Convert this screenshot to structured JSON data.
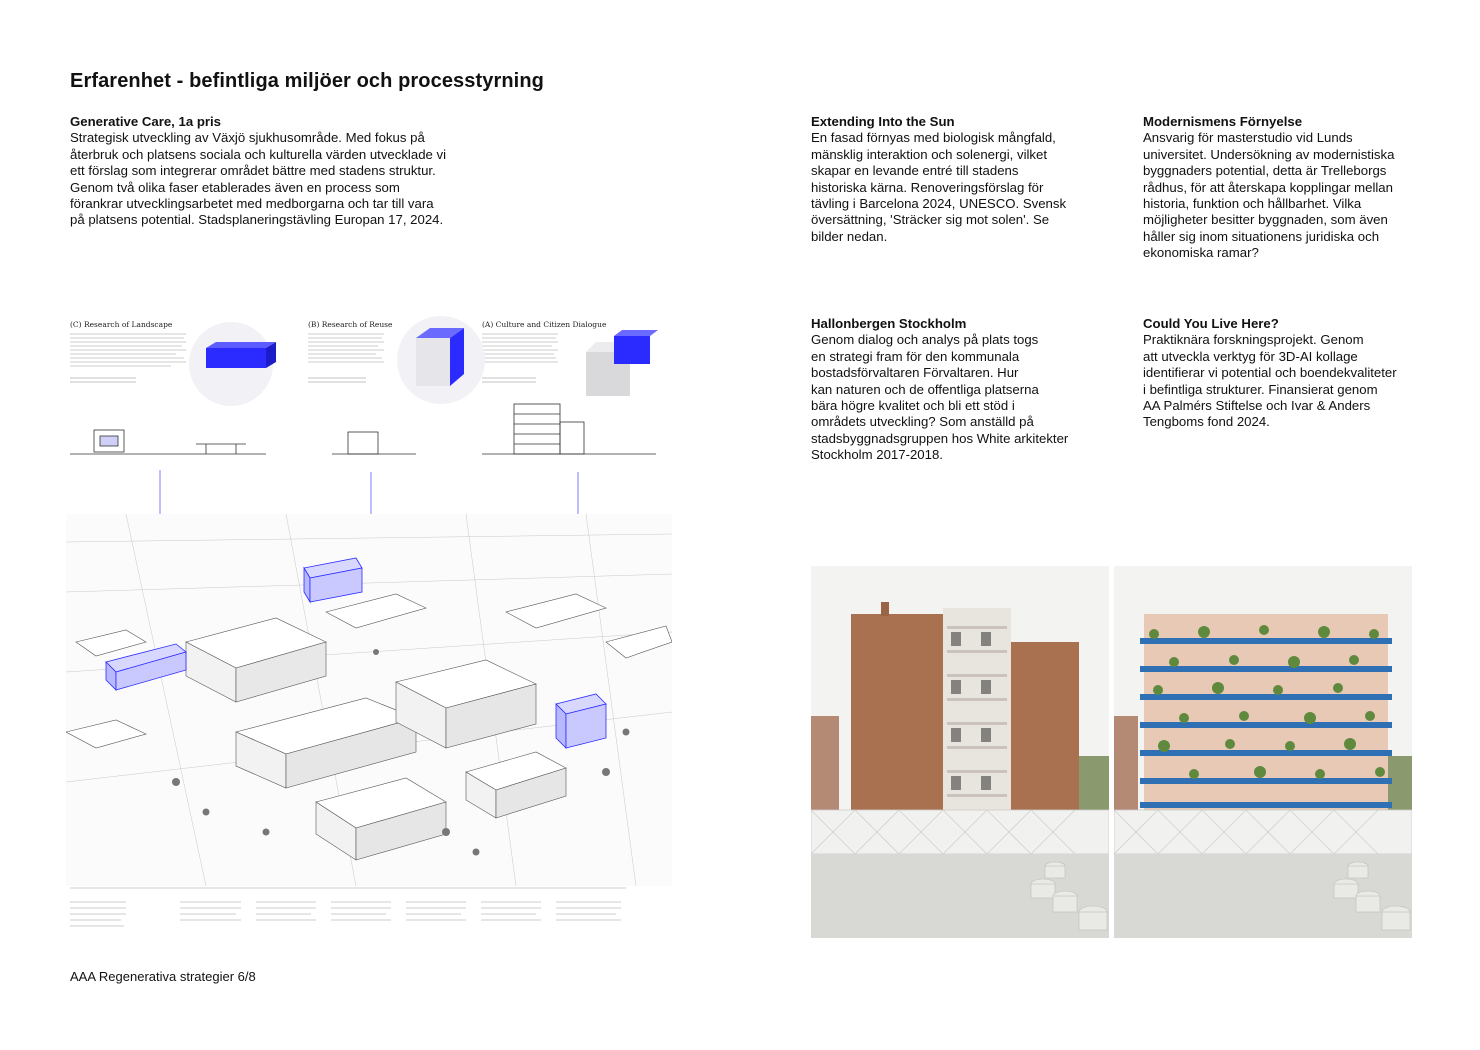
{
  "page": {
    "title": "Erfarenhet - befintliga miljöer och processtyrning",
    "footer": "AAA Regenerativa strategier 6/8"
  },
  "projects": [
    {
      "heading": "Generative Care, 1a pris",
      "text": "Strategisk utveckling av Växjö sjukhusområde. Med fokus på\nåterbruk och platsens sociala och kulturella värden utvecklade vi\nett förslag som integrerar området bättre med stadens struktur.\nGenom två olika faser etablerades även en process som\nförankrar utvecklingsarbetet med medborgarna och tar till vara\npå platsens potential. Stadsplaneringstävling Europan 17, 2024."
    },
    {
      "heading": "Extending Into the Sun",
      "text": "En fasad förnyas med biologisk mångfald,\nmänsklig interaktion och solenergi, vilket\nskapar en levande entré till stadens\nhistoriska kärna. Renoveringsförslag för\ntävling i Barcelona 2024, UNESCO. Svensk\növersättning, 'Sträcker sig mot solen'. Se\nbilder nedan."
    },
    {
      "heading": "Modernismens Förnyelse",
      "text": "Ansvarig för masterstudio vid Lunds\nuniversitet. Undersökning av modernistiska\nbyggnaders potential, detta är Trelleborgs\nrådhus, för att återskapa kopplingar mellan\nhistoria, funktion och hållbarhet. Vilka\nmöjligheter besitter byggnaden, som även\nhåller sig inom situationens juridiska och\nekonomiska ramar?"
    },
    {
      "heading": "Hallonbergen Stockholm",
      "text": "Genom dialog och analys på plats togs\nen strategi fram för den kommunala\nbostadsförvaltaren Förvaltaren. Hur\nkan naturen och de offentliga platserna\nbära högre kvalitet och bli ett stöd i\nområdets utveckling? Som anställd på\nstadsbyggnadsgruppen hos White arkitekter\nStockholm 2017-2018."
    },
    {
      "heading": "Could You Live Here?",
      "text": "Praktiknära forskningsprojekt. Genom\natt utveckla verktyg för 3D-AI kollage\nidentifierar vi potential och boendekvaliteter\ni befintliga strukturer. Finansierat genom\nAA Palmérs Stiftelse och Ivar & Anders\nTengboms fond 2024."
    }
  ],
  "figure_plan": {
    "captions": [
      "(C) Research of Landscape",
      "(B) Research of Reuse",
      "(A) Culture and Citizen Dialogue"
    ],
    "accent_color": "#2b2bff"
  },
  "figure_photos": {
    "brick_color": "#a9714f",
    "balcony_color": "#2f6fb3",
    "sky_color": "#f3f3f1"
  }
}
